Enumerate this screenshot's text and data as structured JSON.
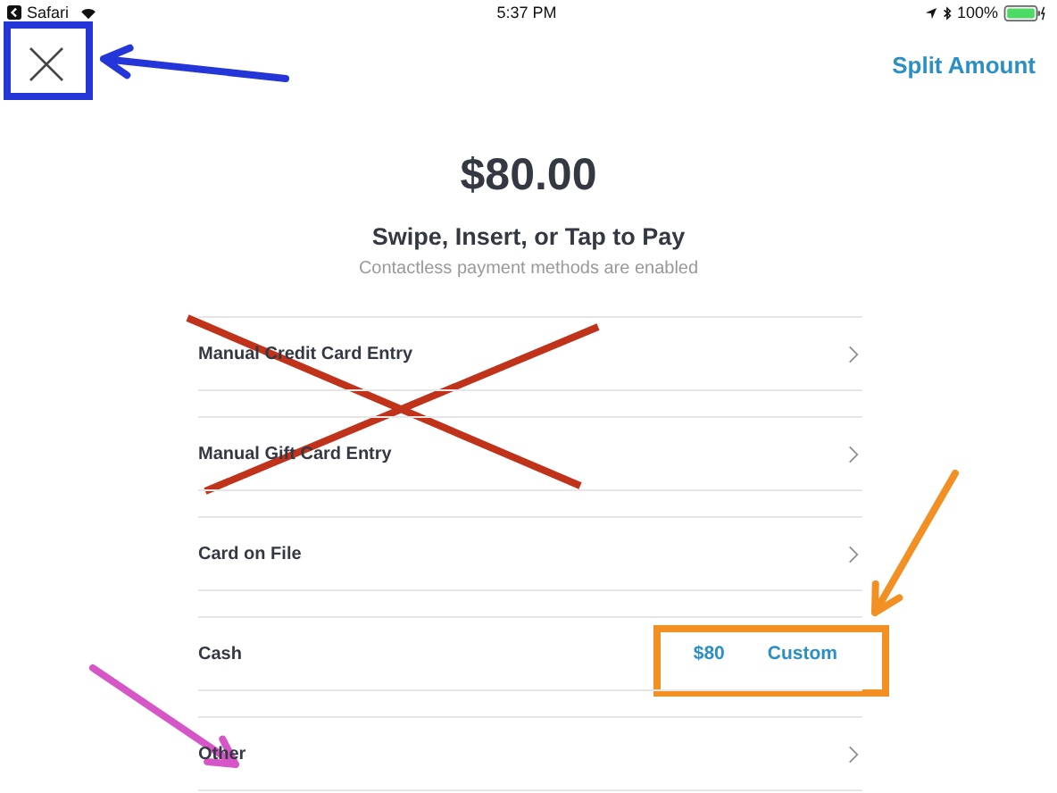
{
  "status_bar": {
    "back_label": "Safari",
    "time": "5:37 PM",
    "battery": "100%"
  },
  "nav": {
    "split_button": "Split Amount"
  },
  "amount": "$80.00",
  "prompt": "Swipe, Insert, or Tap to Pay",
  "note": "Contactless payment methods are enabled",
  "rows": [
    {
      "kind": "chevron",
      "label": "Manual Credit Card Entry"
    },
    {
      "kind": "chevron",
      "label": "Manual Gift Card Entry"
    },
    {
      "kind": "chevron",
      "label": "Card on File"
    },
    {
      "kind": "options",
      "label": "Cash",
      "options": [
        "$80",
        "Custom"
      ]
    },
    {
      "kind": "chevron",
      "label": "Other"
    }
  ],
  "annotations": [
    {
      "kind": "box",
      "color": "#2436d8"
    },
    {
      "kind": "arrow",
      "color": "#2436d8"
    },
    {
      "kind": "cross",
      "color": "#c0321a"
    },
    {
      "kind": "box",
      "color": "#f39024"
    },
    {
      "kind": "arrow",
      "color": "#f39024"
    },
    {
      "kind": "arrow",
      "color": "#d656c8"
    }
  ]
}
